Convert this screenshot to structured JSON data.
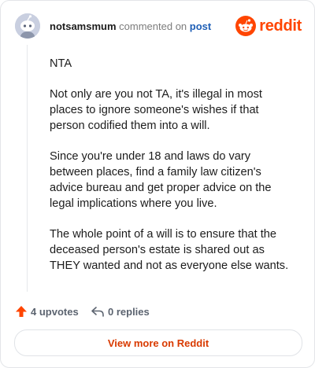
{
  "header": {
    "username": "notsamsmum",
    "action": "commented on",
    "post_link": "post",
    "brand": "reddit"
  },
  "comment": {
    "paragraphs": [
      "NTA",
      "Not only are you not TA, it's illegal in most places to ignore someone's wishes if that person codified them into a will.",
      "Since you're under 18 and laws do vary between places, find a family law citizen's advice bureau and get proper advice on the legal implications where you live.",
      "The whole point of a will is to ensure that the deceased person's estate is shared out as THEY wanted and not as everyone else wants."
    ]
  },
  "footer": {
    "upvotes": "4 upvotes",
    "replies": "0 replies"
  },
  "view_more_label": "View more on Reddit",
  "icons": {
    "avatar": "snoo-avatar-icon",
    "brand": "reddit-logo-icon",
    "upvote": "upvote-arrow-icon",
    "reply": "reply-arrow-icon"
  },
  "colors": {
    "brand": "#ff4500",
    "upvote": "#ff4500",
    "link": "#1f5fb6",
    "view_more": "#d93a00"
  }
}
